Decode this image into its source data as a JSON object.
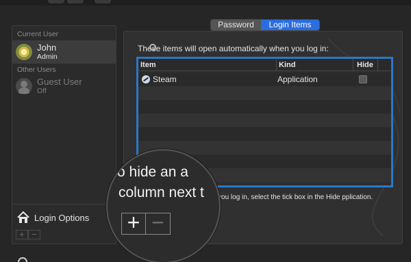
{
  "sidebar": {
    "current_user_header": "Current User",
    "current_user": {
      "name": "John",
      "role": "Admin"
    },
    "other_users_header": "Other Users",
    "other_users": [
      {
        "name": "Guest User",
        "role": "Off"
      }
    ],
    "login_options_label": "Login Options",
    "add_label": "+",
    "remove_label": "−"
  },
  "tabs": [
    {
      "label": "Password",
      "selected": false
    },
    {
      "label": "Login Items",
      "selected": true
    }
  ],
  "login_items": {
    "description": "These items will open automatically when you log in:",
    "columns": {
      "item": "Item",
      "kind": "Kind",
      "hide": "Hide"
    },
    "rows": [
      {
        "item": "Steam",
        "kind": "Application",
        "hide": false
      }
    ],
    "hint": "n when you log in, select the tick box in the Hide pplication."
  },
  "magnifier": {
    "line1": "o hide an a",
    "line2": "column next t",
    "plus": "+",
    "minus": "−"
  },
  "colors": {
    "accent": "#2a6de0",
    "selection_border": "#2a78c8"
  }
}
